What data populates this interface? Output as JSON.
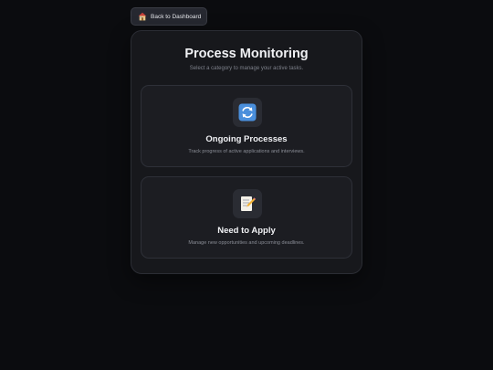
{
  "back_button": {
    "label": "Back to Dashboard",
    "icon": "home-icon"
  },
  "header": {
    "title": "Process Monitoring",
    "subtitle": "Select a category to manage your active tasks."
  },
  "cards": [
    {
      "icon": "refresh-icon",
      "title": "Ongoing Processes",
      "description": "Track progress of active applications and interviews."
    },
    {
      "icon": "memo-icon",
      "title": "Need to Apply",
      "description": "Manage new opportunities and upcoming deadlines."
    }
  ],
  "colors": {
    "background": "#0b0c0f",
    "panel": "#17181c",
    "card": "#1c1d22"
  }
}
